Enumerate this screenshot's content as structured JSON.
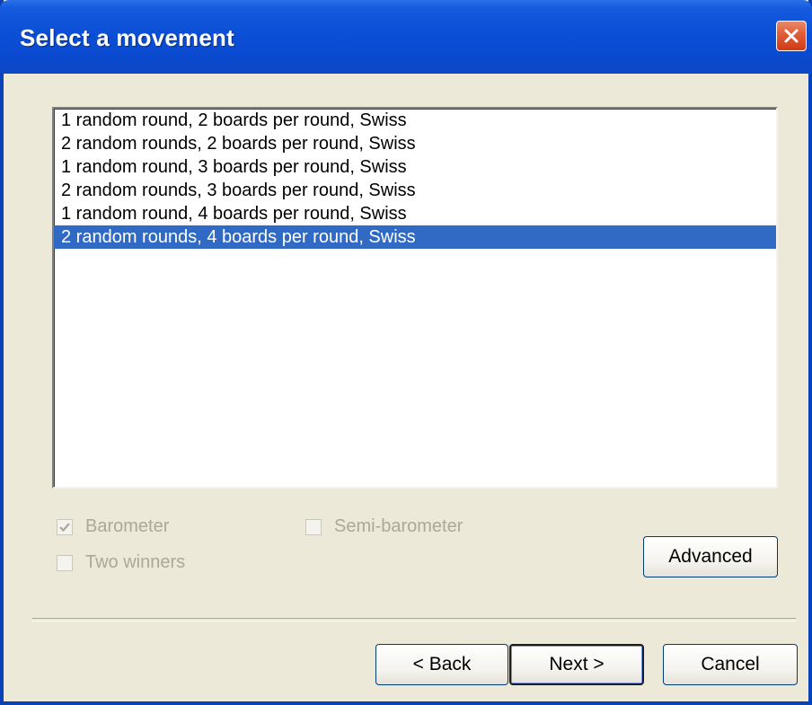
{
  "dialog": {
    "title": "Select a movement"
  },
  "movements": {
    "items": [
      {
        "label": "1 random round, 2 boards per round, Swiss",
        "selected": false
      },
      {
        "label": "2 random rounds, 2 boards per round, Swiss",
        "selected": false
      },
      {
        "label": "1 random round, 3 boards per round, Swiss",
        "selected": false
      },
      {
        "label": "2 random rounds, 3 boards per round, Swiss",
        "selected": false
      },
      {
        "label": "1 random round, 4 boards per round, Swiss",
        "selected": false
      },
      {
        "label": "2 random rounds, 4 boards per round, Swiss",
        "selected": true
      }
    ]
  },
  "options": {
    "barometer": {
      "label": "Barometer",
      "checked": true,
      "enabled": false
    },
    "semi_barometer": {
      "label": "Semi-barometer",
      "checked": false,
      "enabled": false
    },
    "two_winners": {
      "label": "Two winners",
      "checked": false,
      "enabled": false
    }
  },
  "buttons": {
    "advanced": "Advanced",
    "back": "< Back",
    "next": "Next >",
    "cancel": "Cancel"
  },
  "colors": {
    "title_bar": "#0b4fd6",
    "selection": "#316ac5",
    "disabled_text": "#aca899",
    "face": "#ece9d8"
  }
}
